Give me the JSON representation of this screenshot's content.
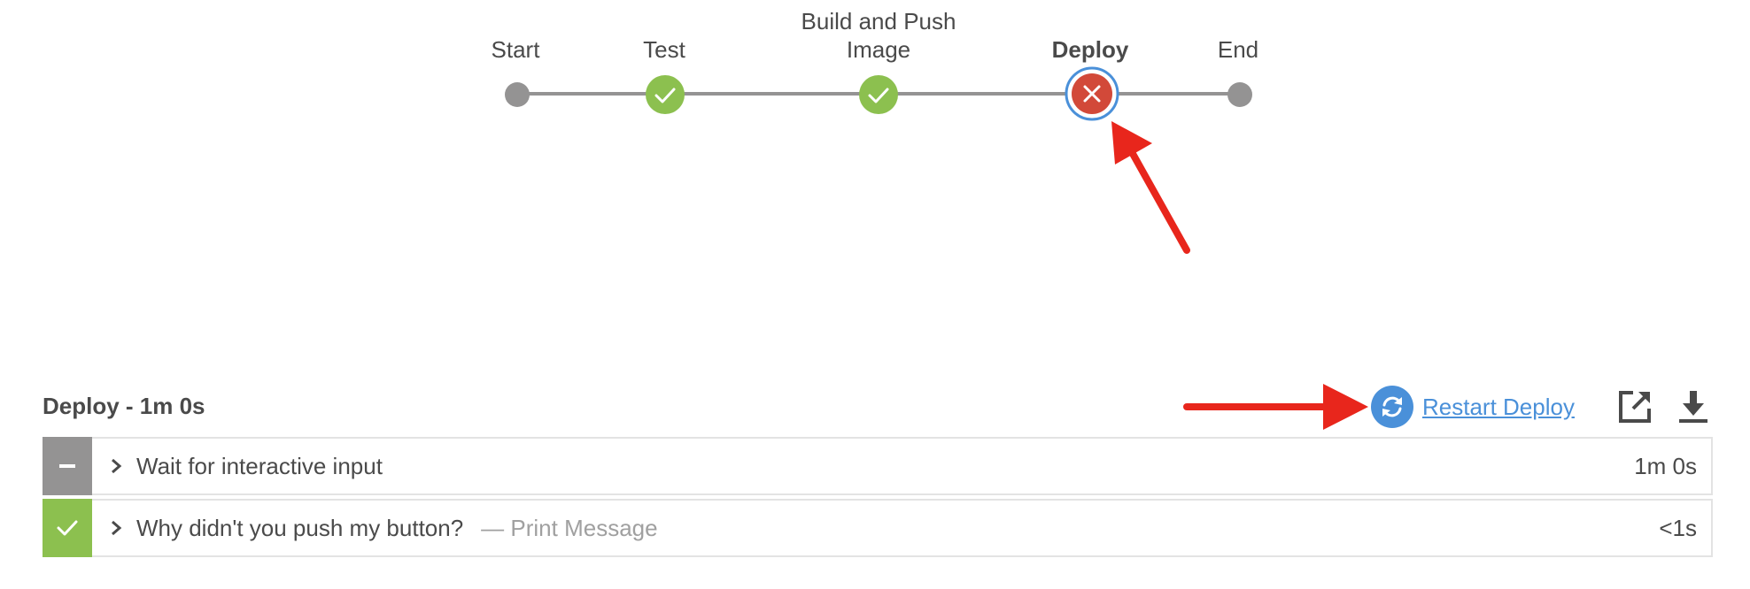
{
  "pipeline": {
    "stages": [
      {
        "label_line1": "",
        "label_line2": "Start",
        "status": "none"
      },
      {
        "label_line1": "",
        "label_line2": "Test",
        "status": "success"
      },
      {
        "label_line1": "Build and Push",
        "label_line2": "Image",
        "status": "success"
      },
      {
        "label_line1": "",
        "label_line2": "Deploy",
        "status": "failed",
        "selected": true
      },
      {
        "label_line1": "",
        "label_line2": "End",
        "status": "none"
      }
    ]
  },
  "stage_detail": {
    "title": "Deploy - 1m 0s",
    "restart_label": "Restart Deploy",
    "steps": [
      {
        "name": "Wait for interactive input",
        "sub": "",
        "duration": "1m 0s",
        "status": "paused"
      },
      {
        "name": "Why didn't you push my button?",
        "sub": "— Print Message",
        "duration": "<1s",
        "status": "success"
      }
    ]
  },
  "colors": {
    "success": "#8cc04f",
    "failed": "#d24939",
    "selected_ring": "#4a90d9",
    "neutral": "#949393",
    "link": "#4a90d9",
    "annotation_arrow": "#e8261c"
  },
  "icons": {
    "restart": "restart-icon",
    "open_external": "open-external-icon",
    "download": "download-icon",
    "chevron": "chevron-right-icon",
    "check": "check-icon",
    "close": "close-icon",
    "minus": "minus-icon"
  }
}
